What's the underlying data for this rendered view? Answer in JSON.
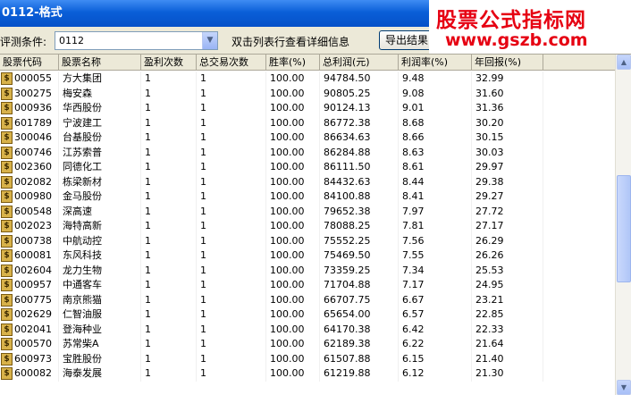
{
  "window": {
    "title": "0112-格式"
  },
  "toolbar": {
    "condition_label": "评测条件:",
    "condition_value": "0112",
    "hint": "双击列表行查看详细信息",
    "export_label": "导出结果"
  },
  "watermark": {
    "line1": "股票公式指标网",
    "line2": "www.gszb.com"
  },
  "columns": [
    "股票代码",
    "股票名称",
    "盈利次数",
    "总交易次数",
    "胜率(%)",
    "总利润(元)",
    "利润率(%)",
    "年回报(%)"
  ],
  "row_icon": "$",
  "rows": [
    [
      "000055",
      "方大集团",
      "1",
      "1",
      "100.00",
      "94784.50",
      "9.48",
      "32.99"
    ],
    [
      "300275",
      "梅安森",
      "1",
      "1",
      "100.00",
      "90805.25",
      "9.08",
      "31.60"
    ],
    [
      "000936",
      "华西股份",
      "1",
      "1",
      "100.00",
      "90124.13",
      "9.01",
      "31.36"
    ],
    [
      "601789",
      "宁波建工",
      "1",
      "1",
      "100.00",
      "86772.38",
      "8.68",
      "30.20"
    ],
    [
      "300046",
      "台基股份",
      "1",
      "1",
      "100.00",
      "86634.63",
      "8.66",
      "30.15"
    ],
    [
      "600746",
      "江苏索普",
      "1",
      "1",
      "100.00",
      "86284.88",
      "8.63",
      "30.03"
    ],
    [
      "002360",
      "同德化工",
      "1",
      "1",
      "100.00",
      "86111.50",
      "8.61",
      "29.97"
    ],
    [
      "002082",
      "栋梁新材",
      "1",
      "1",
      "100.00",
      "84432.63",
      "8.44",
      "29.38"
    ],
    [
      "000980",
      "金马股份",
      "1",
      "1",
      "100.00",
      "84100.88",
      "8.41",
      "29.27"
    ],
    [
      "600548",
      "深高速",
      "1",
      "1",
      "100.00",
      "79652.38",
      "7.97",
      "27.72"
    ],
    [
      "002023",
      "海特高新",
      "1",
      "1",
      "100.00",
      "78088.25",
      "7.81",
      "27.17"
    ],
    [
      "000738",
      "中航动控",
      "1",
      "1",
      "100.00",
      "75552.25",
      "7.56",
      "26.29"
    ],
    [
      "600081",
      "东风科技",
      "1",
      "1",
      "100.00",
      "75469.50",
      "7.55",
      "26.26"
    ],
    [
      "002604",
      "龙力生物",
      "1",
      "1",
      "100.00",
      "73359.25",
      "7.34",
      "25.53"
    ],
    [
      "000957",
      "中通客车",
      "1",
      "1",
      "100.00",
      "71704.88",
      "7.17",
      "24.95"
    ],
    [
      "600775",
      "南京熊猫",
      "1",
      "1",
      "100.00",
      "66707.75",
      "6.67",
      "23.21"
    ],
    [
      "002629",
      "仁智油服",
      "1",
      "1",
      "100.00",
      "65654.00",
      "6.57",
      "22.85"
    ],
    [
      "002041",
      "登海种业",
      "1",
      "1",
      "100.00",
      "64170.38",
      "6.42",
      "22.33"
    ],
    [
      "000570",
      "苏常柴A",
      "1",
      "1",
      "100.00",
      "62189.38",
      "6.22",
      "21.64"
    ],
    [
      "600973",
      "宝胜股份",
      "1",
      "1",
      "100.00",
      "61507.88",
      "6.15",
      "21.40"
    ],
    [
      "600082",
      "海泰发展",
      "1",
      "1",
      "100.00",
      "61219.88",
      "6.12",
      "21.30"
    ]
  ]
}
